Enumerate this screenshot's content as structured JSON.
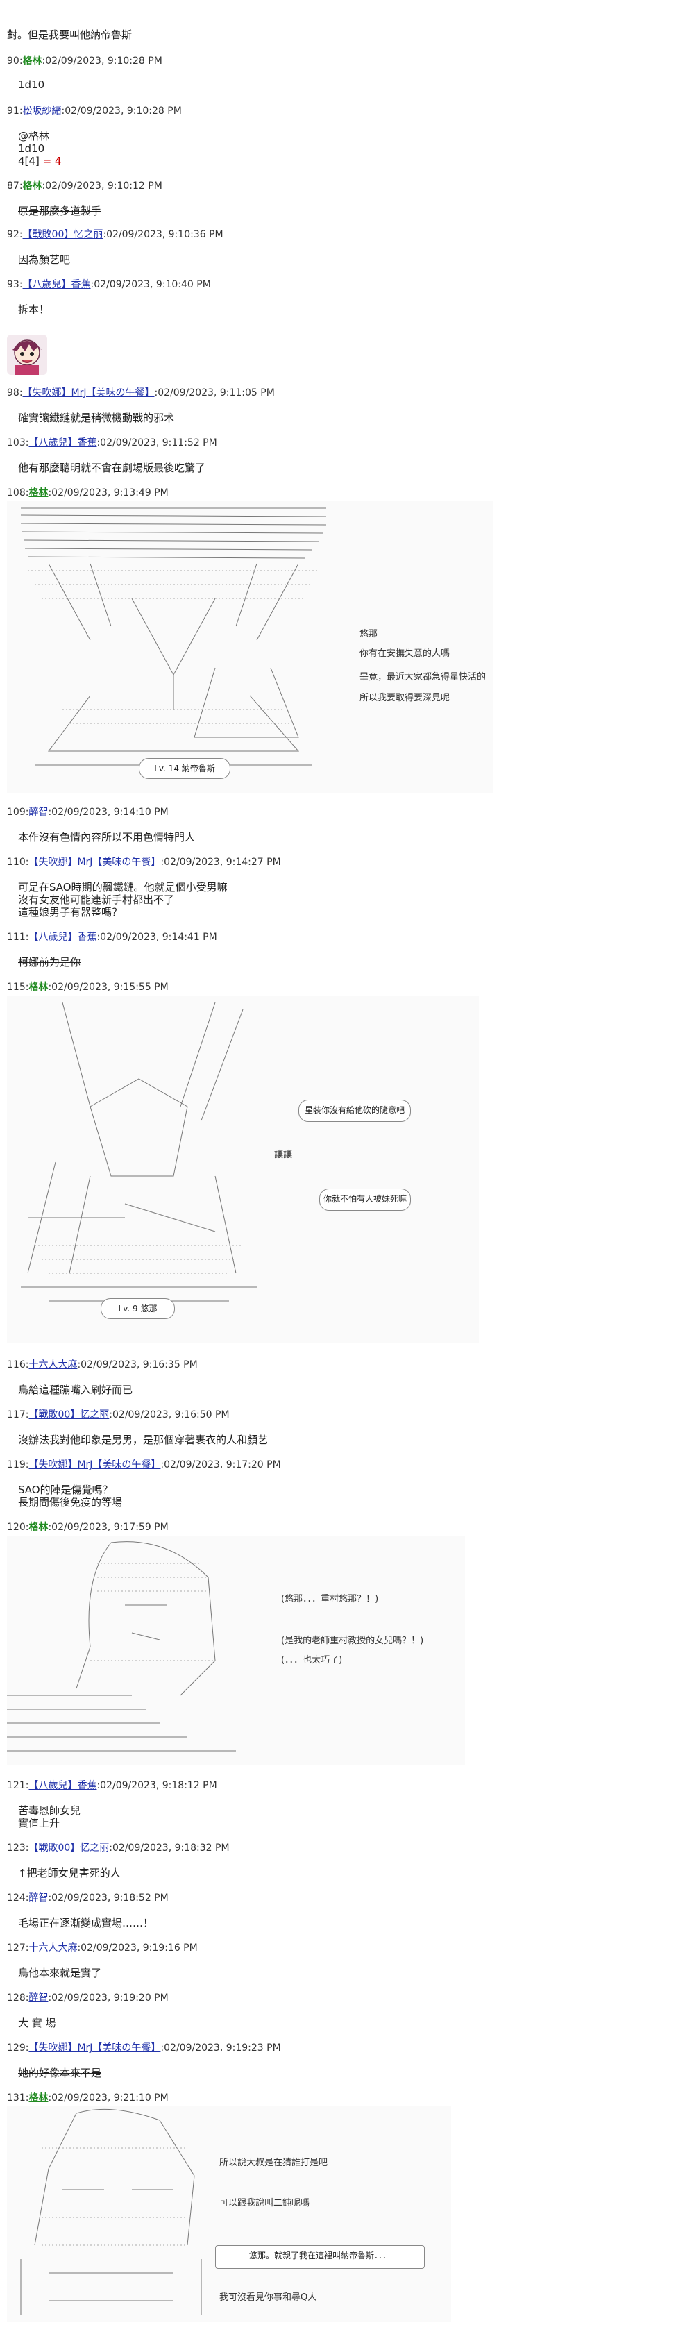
{
  "posts": [
    {
      "line": "對。但是我要叫他納帝魯斯"
    },
    {
      "num": "90",
      "name": "格林",
      "date": "02/09/2023, 9:10:28 PM",
      "body": [
        "1d10"
      ]
    },
    {
      "num": "91",
      "name": "松坂紗緒",
      "date": "02/09/2023, 9:10:28 PM",
      "body": [
        "@格林",
        "1d10"
      ],
      "roll_prefix": "4[4]",
      "roll_result": "= 4"
    },
    {
      "num": "87",
      "name": "格林",
      "date": "02/09/2023, 9:10:12 PM",
      "body": [
        "原是那麼多道製手"
      ]
    },
    {
      "num": "92",
      "name": "【戰敗00】忆之丽",
      "date": "02/09/2023, 9:10:36 PM",
      "body": [
        "因為顏艺吧"
      ]
    },
    {
      "num": "93",
      "name": "【八歲兒】香蕉",
      "date": "02/09/2023, 9:10:40 PM",
      "body": [
        "拆本！"
      ]
    },
    {
      "num": "98",
      "name": "【失吹娜】MrJ【美味の午餐】",
      "date": "02/09/2023, 9:11:05 PM",
      "body": [
        "確實讓鐵鏈就是稍微機動戰的邪术"
      ]
    },
    {
      "num": "103",
      "name": "【八歲兒】香蕉",
      "date": "02/09/2023, 9:11:52 PM",
      "body": [
        "他有那麼聰明就不會在劇場版最後吃驚了"
      ]
    },
    {
      "num": "108",
      "name": "格林",
      "date": "02/09/2023, 9:13:49 PM"
    },
    {
      "num": "109",
      "name": "醉智",
      "date": "02/09/2023, 9:14:10 PM",
      "body": [
        "本作沒有色情內容所以不用色情特門人"
      ]
    },
    {
      "num": "110",
      "name": "【失吹娜】MrJ【美味の午餐】",
      "date": "02/09/2023, 9:14:27 PM",
      "body": [
        "可是在SAO時期的飄鐵鏈。他就是個小受男嘛",
        "沒有女友他可能連新手村都出不了",
        "這種娘男子有器整嗎？"
      ]
    },
    {
      "num": "111",
      "name": "【八歲兒】香蕉",
      "date": "02/09/2023, 9:14:41 PM",
      "body": [
        "柯娜前为是你"
      ]
    },
    {
      "num": "115",
      "name": "格林",
      "date": "02/09/2023, 9:15:55 PM"
    },
    {
      "num": "116",
      "name": "十六人大麻",
      "date": "02/09/2023, 9:16:35 PM",
      "body": [
        "鳥給這種蹦嘴入刷好而已"
      ]
    },
    {
      "num": "117",
      "name": "【戰敗00】忆之丽",
      "date": "02/09/2023, 9:16:50 PM",
      "body": [
        "沒辦法我對他印象是男男，是那個穿著裹衣的人和顏艺"
      ]
    },
    {
      "num": "119",
      "name": "【失吹娜】MrJ【美味の午餐】",
      "date": "02/09/2023, 9:17:20 PM",
      "body": [
        "SAO的陣是傷覺嗎？",
        "長期間傷後免疫的等場"
      ]
    },
    {
      "num": "120",
      "name": "格林",
      "date": "02/09/2023, 9:17:59 PM"
    },
    {
      "num": "121",
      "name": "【八歲兒】香蕉",
      "date": "02/09/2023, 9:18:12 PM",
      "body": [
        "苦毒恩師女兒",
        "實值上升"
      ]
    },
    {
      "num": "123",
      "name": "【戰敗00】忆之丽",
      "date": "02/09/2023, 9:18:32 PM",
      "body": [
        "↑把老師女兒害死的人"
      ]
    },
    {
      "num": "124",
      "name": "醉智",
      "date": "02/09/2023, 9:18:52 PM",
      "body": [
        "毛場正在逐漸變成實場……！"
      ]
    },
    {
      "num": "127",
      "name": "十六人大麻",
      "date": "02/09/2023, 9:19:16 PM",
      "body": [
        "鳥他本來就是實了"
      ]
    },
    {
      "num": "128",
      "name": "醉智",
      "date": "02/09/2023, 9:19:20 PM",
      "body": [
        "大 實 場"
      ]
    },
    {
      "num": "129",
      "name": "【失吹娜】MrJ【美味の午餐】",
      "date": "02/09/2023, 9:19:23 PM",
      "body": [
        "她的好像本來不是"
      ]
    },
    {
      "num": "131",
      "name": "格林",
      "date": "02/09/2023, 9:21:10 PM"
    }
  ],
  "aa1": {
    "side_lines": [
      "悠那",
      "你有在安撫失意的人嗎",
      "畢竟，最近大家都急得量快活的",
      "所以我要取得要深見呢"
    ],
    "level": "Lv. 14 納帝魯斯"
  },
  "aa2": {
    "bubble1": "星裝你沒有給他砍的隨意吧",
    "mid": "讓讓",
    "bubble2": "你就不怕有人被妹死嘛",
    "level": "Lv. 9 悠那"
  },
  "aa3": {
    "lines": [
      "(悠那．．．重村悠那？！)",
      "(是我的老師重村教授的女兒嗎？！)",
      "(．．．也太巧了)"
    ]
  },
  "aa4": {
    "lines": [
      "所以說大叔是在猜誰打是吧",
      "可以跟我說叫二鈍呢嗎",
      "悠那。就親了我在這裡叫納帝魯斯．．．",
      "我可沒看見你事和尋Q人"
    ]
  },
  "colors": {
    "name_green": "#228b22",
    "name_blue": "#2233aa",
    "dice_red": "#cc0000"
  }
}
